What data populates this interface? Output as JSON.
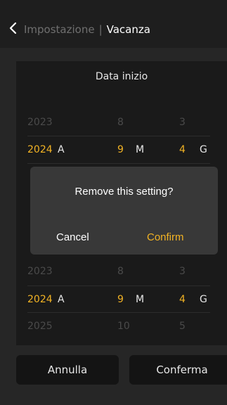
{
  "header": {
    "parent_label": "Impostazione",
    "separator": "|",
    "current_label": "Vacanza"
  },
  "start_picker": {
    "title": "Data inizio",
    "rows": [
      {
        "year": "2023",
        "month": "8",
        "day": "3"
      },
      {
        "year": "2024",
        "year_unit": "A",
        "month": "9",
        "month_unit": "M",
        "day": "4",
        "day_unit": "G"
      }
    ]
  },
  "end_picker": {
    "rows": [
      {
        "year": "2023",
        "month": "8",
        "day": "3"
      },
      {
        "year": "2024",
        "year_unit": "A",
        "month": "9",
        "month_unit": "M",
        "day": "4",
        "day_unit": "G"
      },
      {
        "year": "2025",
        "month": "10",
        "day": "5"
      }
    ]
  },
  "footer": {
    "cancel_label": "Annulla",
    "confirm_label": "Conferma"
  },
  "dialog": {
    "message": "Remove this setting?",
    "cancel_label": "Cancel",
    "confirm_label": "Confirm"
  },
  "colors": {
    "accent": "#f2b324",
    "background": "#262626",
    "panel": "#1a1a1a",
    "dialog": "#383838"
  }
}
